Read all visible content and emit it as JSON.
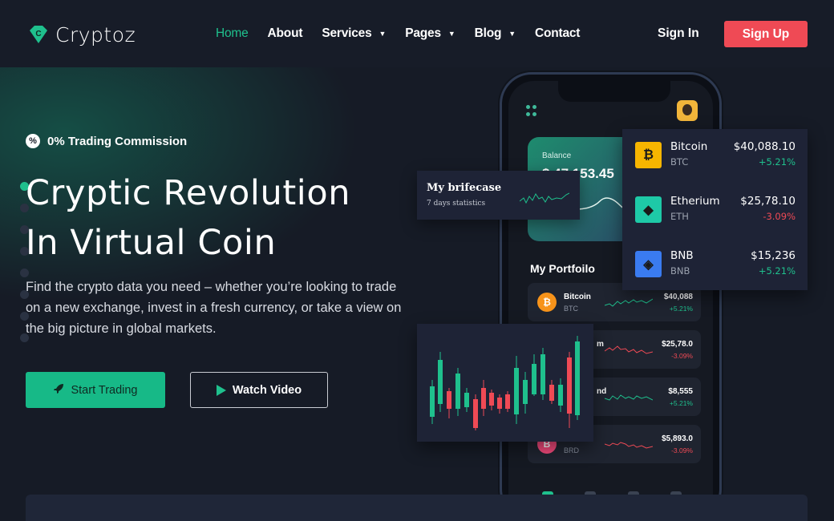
{
  "brand": {
    "name": "Cryptoz",
    "accent": "#1fc08d",
    "danger": "#ef4a55"
  },
  "nav": {
    "items": [
      {
        "label": "Home",
        "active": true,
        "dropdown": false
      },
      {
        "label": "About",
        "active": false,
        "dropdown": false
      },
      {
        "label": "Services",
        "active": false,
        "dropdown": true
      },
      {
        "label": "Pages",
        "active": false,
        "dropdown": true
      },
      {
        "label": "Blog",
        "active": false,
        "dropdown": true
      },
      {
        "label": "Contact",
        "active": false,
        "dropdown": false
      }
    ],
    "signin": "Sign In",
    "signup": "Sign Up"
  },
  "hero": {
    "badge": "0% Trading Commission",
    "title_line1": "Cryptic Revolution",
    "title_line2": "In Virtual Coin",
    "lead": "Find the crypto data you need – whether you’re looking to trade on a new exchange, invest in a fresh currency, or take a view on the big picture in global markets.",
    "start_label": "Start Trading",
    "watch_label": "Watch Video"
  },
  "phone": {
    "balance_label": "Balance",
    "balance_value": "$ 47,153.45",
    "portfolio_title": "My Portfoilo",
    "portfolio": [
      {
        "name": "Bitcoin",
        "symbol": "BTC",
        "value": "$40,088",
        "change": "+5.21%",
        "dir": "up",
        "color": "#f7931a",
        "glyph": "₿"
      },
      {
        "name": "m",
        "symbol": "",
        "value": "$25,78.0",
        "change": "-3.09%",
        "dir": "down",
        "color": "#627eea",
        "glyph": ""
      },
      {
        "name": "nd",
        "symbol": "",
        "value": "$8,555",
        "change": "+5.21%",
        "dir": "up",
        "color": "#2a5ada",
        "glyph": ""
      },
      {
        "name": "",
        "symbol": "BRD",
        "value": "$5,893.0",
        "change": "-3.09%",
        "dir": "down",
        "color": "#f0497a",
        "glyph": "B"
      }
    ]
  },
  "briefcase": {
    "title": "My brifecase",
    "subtitle": "7 days statistics"
  },
  "market": [
    {
      "name": "Bitcoin",
      "symbol": "BTC",
      "value": "$40,088.10",
      "change": "+5.21%",
      "dir": "up",
      "color": "#f7b500",
      "glyph": "₿",
      "icon": "bitcoin-icon"
    },
    {
      "name": "Etherium",
      "symbol": "ETH",
      "value": "$25,78.10",
      "change": "-3.09%",
      "dir": "down",
      "color": "#1ec9a7",
      "glyph": "◆",
      "icon": "ethereum-icon"
    },
    {
      "name": "BNB",
      "symbol": "BNB",
      "value": "$15,236",
      "change": "+5.21%",
      "dir": "up",
      "color": "#3a7bf0",
      "glyph": "◈",
      "icon": "bnb-icon"
    }
  ]
}
